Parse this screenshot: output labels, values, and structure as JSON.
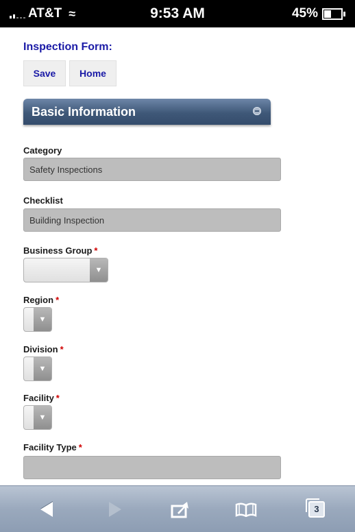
{
  "status_bar": {
    "carrier": "AT&T",
    "time": "9:53 AM",
    "battery": "45%"
  },
  "form": {
    "title": "Inspection Form:",
    "save_label": "Save",
    "home_label": "Home"
  },
  "section": {
    "title": "Basic Information"
  },
  "fields": {
    "category": {
      "label": "Category",
      "value": "Safety Inspections"
    },
    "checklist": {
      "label": "Checklist",
      "value": "Building Inspection"
    },
    "business_group": {
      "label": "Business Group",
      "required": "*",
      "value": ""
    },
    "region": {
      "label": "Region",
      "required": "*",
      "value": ""
    },
    "division": {
      "label": "Division",
      "required": "*",
      "value": ""
    },
    "facility": {
      "label": "Facility",
      "required": "*",
      "value": ""
    },
    "facility_type": {
      "label": "Facility Type",
      "required": "*",
      "value": ""
    }
  },
  "toolbar": {
    "tabs_count": "3",
    "icons": [
      "back-icon",
      "forward-icon",
      "share-icon",
      "bookmarks-icon",
      "tabs-icon"
    ]
  },
  "colors": {
    "link_blue": "#1a1aa6",
    "header_blue": "#3f5878",
    "required_red": "#d00000",
    "toolbar": "#9aa9bd"
  }
}
